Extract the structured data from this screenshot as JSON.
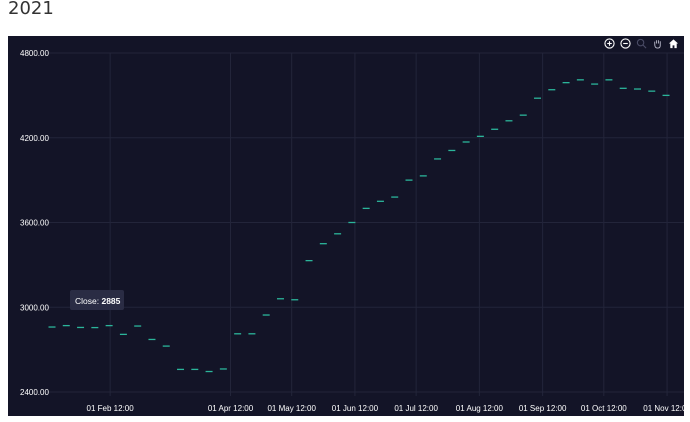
{
  "page": {
    "title": "2021"
  },
  "toolbar": {
    "buttons": [
      {
        "name": "zoom-in-icon"
      },
      {
        "name": "zoom-out-icon"
      },
      {
        "name": "zoom-select-icon"
      },
      {
        "name": "pan-hand-icon"
      },
      {
        "name": "home-reset-icon"
      }
    ]
  },
  "tooltip": {
    "label": "Close:",
    "value": "2885"
  },
  "colors": {
    "background": "#131427",
    "grid": "#23253a",
    "marker": "#2bb59a",
    "text": "#ffffff",
    "tooltip_bg": "#2a2c44"
  },
  "chart_data": {
    "type": "scatter",
    "title": "",
    "xlabel": "",
    "ylabel": "",
    "ylim": [
      2400,
      4800
    ],
    "y_ticks": [
      "4800.00",
      "4200.00",
      "3600.00",
      "3000.00",
      "2400.00"
    ],
    "x_ticks": [
      "01 Feb 12:00",
      "01 Apr 12:00",
      "01 May 12:00",
      "01 Jun 12:00",
      "01 Jul 12:00",
      "01 Aug 12:00",
      "01 Sep 12:00",
      "01 Oct 12:00",
      "01 Nov 12:00"
    ],
    "series": [
      {
        "name": "Close",
        "x": [
          "2021-01-04",
          "2021-01-11",
          "2021-01-18",
          "2021-01-25",
          "2021-02-01",
          "2021-02-08",
          "2021-02-15",
          "2021-02-22",
          "2021-03-01",
          "2021-03-08",
          "2021-03-15",
          "2021-03-22",
          "2021-03-29",
          "2021-04-05",
          "2021-04-12",
          "2021-04-19",
          "2021-04-26",
          "2021-05-03",
          "2021-05-10",
          "2021-05-17",
          "2021-05-24",
          "2021-05-31",
          "2021-06-07",
          "2021-06-14",
          "2021-06-21",
          "2021-06-28",
          "2021-07-05",
          "2021-07-12",
          "2021-07-19",
          "2021-07-26",
          "2021-08-02",
          "2021-08-09",
          "2021-08-16",
          "2021-08-23",
          "2021-08-30",
          "2021-09-06",
          "2021-09-13",
          "2021-09-20",
          "2021-09-27",
          "2021-10-04",
          "2021-10-11",
          "2021-10-18",
          "2021-10-25",
          "2021-11-01"
        ],
        "values": [
          2860,
          2870,
          2857,
          2856,
          2870,
          2808,
          2867,
          2772,
          2725,
          2560,
          2560,
          2545,
          2563,
          2812,
          2812,
          2945,
          3060,
          3053,
          3330,
          3450,
          3520,
          3600,
          3700,
          3750,
          3780,
          3900,
          3930,
          4050,
          4110,
          4170,
          4210,
          4260,
          4320,
          4360,
          4480,
          4540,
          4590,
          4610,
          4580,
          4610,
          4550,
          4545,
          4530,
          4500
        ]
      }
    ]
  }
}
